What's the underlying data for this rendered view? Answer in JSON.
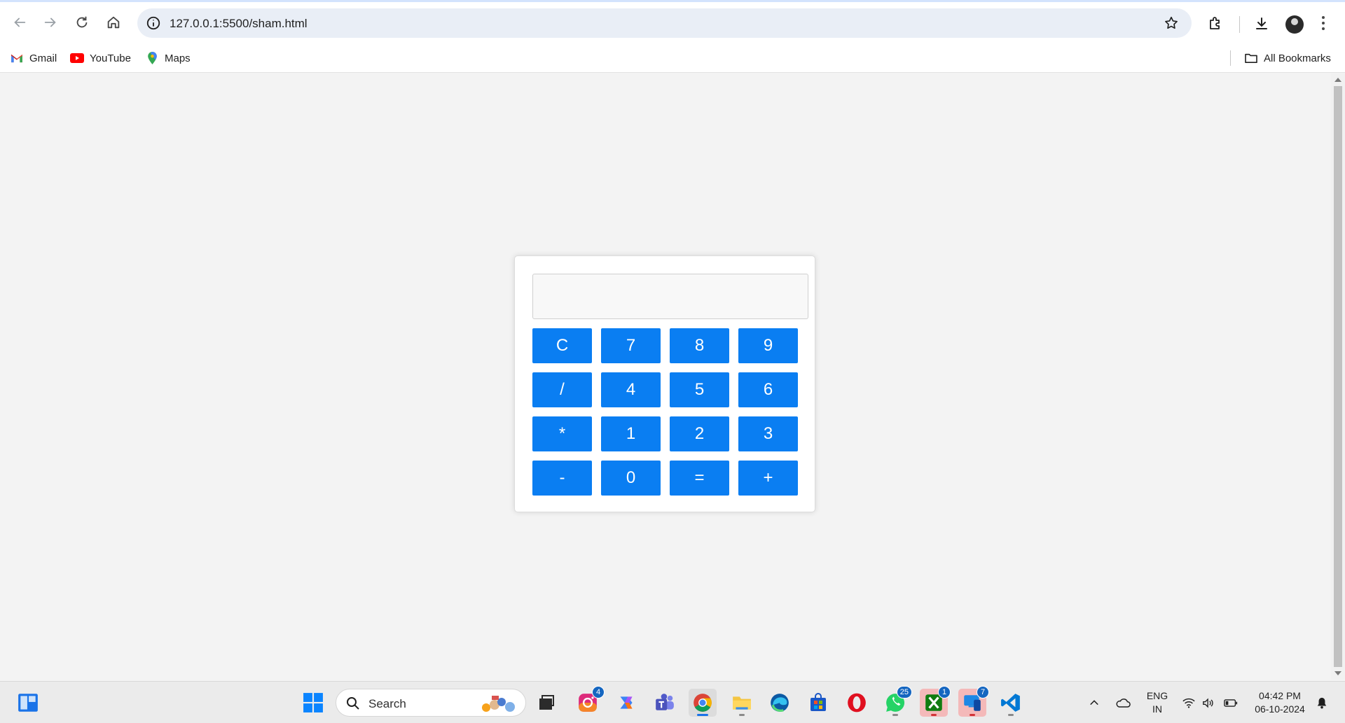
{
  "browser": {
    "url": "127.0.0.1:5500/sham.html",
    "bookmarks": [
      {
        "label": "Gmail",
        "icon": "gmail-icon"
      },
      {
        "label": "YouTube",
        "icon": "youtube-icon"
      },
      {
        "label": "Maps",
        "icon": "maps-icon"
      }
    ],
    "all_bookmarks_label": "All Bookmarks"
  },
  "calculator": {
    "display_value": "",
    "keys": [
      "C",
      "7",
      "8",
      "9",
      "/",
      "4",
      "5",
      "6",
      "*",
      "1",
      "2",
      "3",
      "-",
      "0",
      "=",
      "+"
    ],
    "key_color": "#0a7ef2"
  },
  "taskbar": {
    "search_placeholder": "Search",
    "badges": {
      "instagram": "4",
      "whatsapp": "25",
      "xbox": "1",
      "app7": "7"
    },
    "language_line1": "ENG",
    "language_line2": "IN",
    "time": "04:42 PM",
    "date": "06-10-2024"
  }
}
